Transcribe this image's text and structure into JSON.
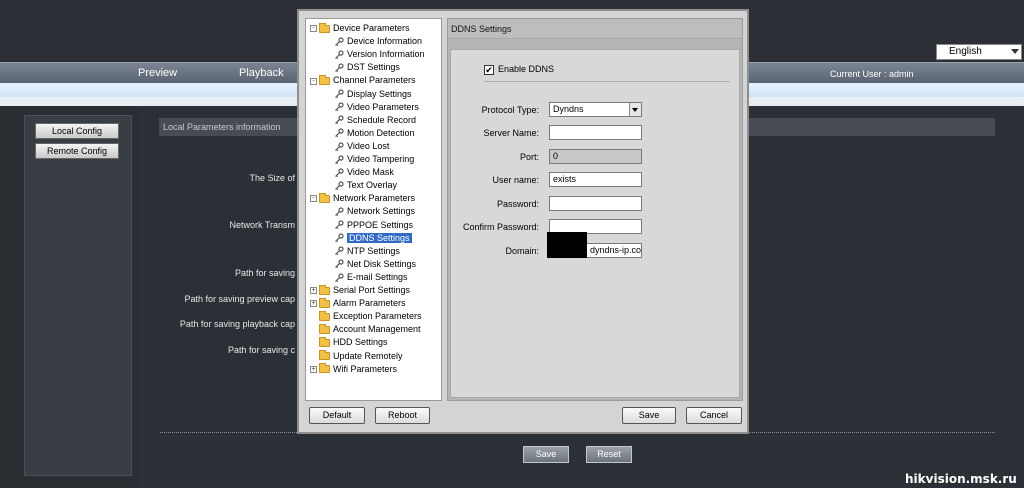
{
  "language": {
    "selected": "English"
  },
  "nav": {
    "items": [
      "Preview",
      "Playback"
    ],
    "current_user": "Current User : admin"
  },
  "left_panel": {
    "local_config": "Local Config",
    "remote_config": "Remote Config"
  },
  "main": {
    "info_title": "Local Parameters information",
    "labels": [
      "The Size of",
      "Network Transm",
      "Path for saving",
      "Path for saving preview cap",
      "Path for saving playback cap",
      "Path for saving c"
    ],
    "save": "Save",
    "reset": "Reset"
  },
  "dialog": {
    "tree": [
      {
        "label": "Device Parameters",
        "type": "folder",
        "expander": "-"
      },
      {
        "label": "Device Information",
        "type": "leaf"
      },
      {
        "label": "Version Information",
        "type": "leaf"
      },
      {
        "label": "DST Settings",
        "type": "leaf"
      },
      {
        "label": "Channel Parameters",
        "type": "folder",
        "expander": "-"
      },
      {
        "label": "Display Settings",
        "type": "leaf"
      },
      {
        "label": "Video Parameters",
        "type": "leaf"
      },
      {
        "label": "Schedule Record",
        "type": "leaf"
      },
      {
        "label": "Motion Detection",
        "type": "leaf"
      },
      {
        "label": "Video Lost",
        "type": "leaf"
      },
      {
        "label": "Video Tampering",
        "type": "leaf"
      },
      {
        "label": "Video Mask",
        "type": "leaf"
      },
      {
        "label": "Text Overlay",
        "type": "leaf"
      },
      {
        "label": "Network Parameters",
        "type": "folder",
        "expander": "-"
      },
      {
        "label": "Network Settings",
        "type": "leaf"
      },
      {
        "label": "PPPOE Settings",
        "type": "leaf"
      },
      {
        "label": "DDNS Settings",
        "type": "leaf",
        "selected": true
      },
      {
        "label": "NTP Settings",
        "type": "leaf"
      },
      {
        "label": "Net Disk Settings",
        "type": "leaf"
      },
      {
        "label": "E-mail Settings",
        "type": "leaf"
      },
      {
        "label": "Serial Port Settings",
        "type": "folder",
        "expander": "+"
      },
      {
        "label": "Alarm Parameters",
        "type": "folder",
        "expander": "+"
      },
      {
        "label": "Exception Parameters",
        "type": "folder"
      },
      {
        "label": "Account Management",
        "type": "folder"
      },
      {
        "label": "HDD Settings",
        "type": "folder"
      },
      {
        "label": "Update Remotely",
        "type": "folder"
      },
      {
        "label": "Wifi Parameters",
        "type": "folder",
        "expander": "+"
      }
    ],
    "settings_title": "DDNS Settings",
    "enable_ddns": {
      "label": "Enable DDNS",
      "checked": true,
      "mark": "✔"
    },
    "fields": {
      "protocol_type": {
        "label": "Protocol Type:",
        "value": "Dyndns"
      },
      "server_name": {
        "label": "Server Name:",
        "value": ""
      },
      "port": {
        "label": "Port:",
        "value": "0"
      },
      "user_name": {
        "label": "User name:",
        "value": "exists"
      },
      "password": {
        "label": "Password:",
        "value": ""
      },
      "confirm_password": {
        "label": "Confirm Password:",
        "value": ""
      },
      "domain": {
        "label": "Domain:",
        "value": "dyndns-ip.cor"
      }
    },
    "buttons": {
      "default": "Default",
      "reboot": "Reboot",
      "save": "Save",
      "cancel": "Cancel"
    }
  },
  "watermark": "hikvision.msk.ru"
}
